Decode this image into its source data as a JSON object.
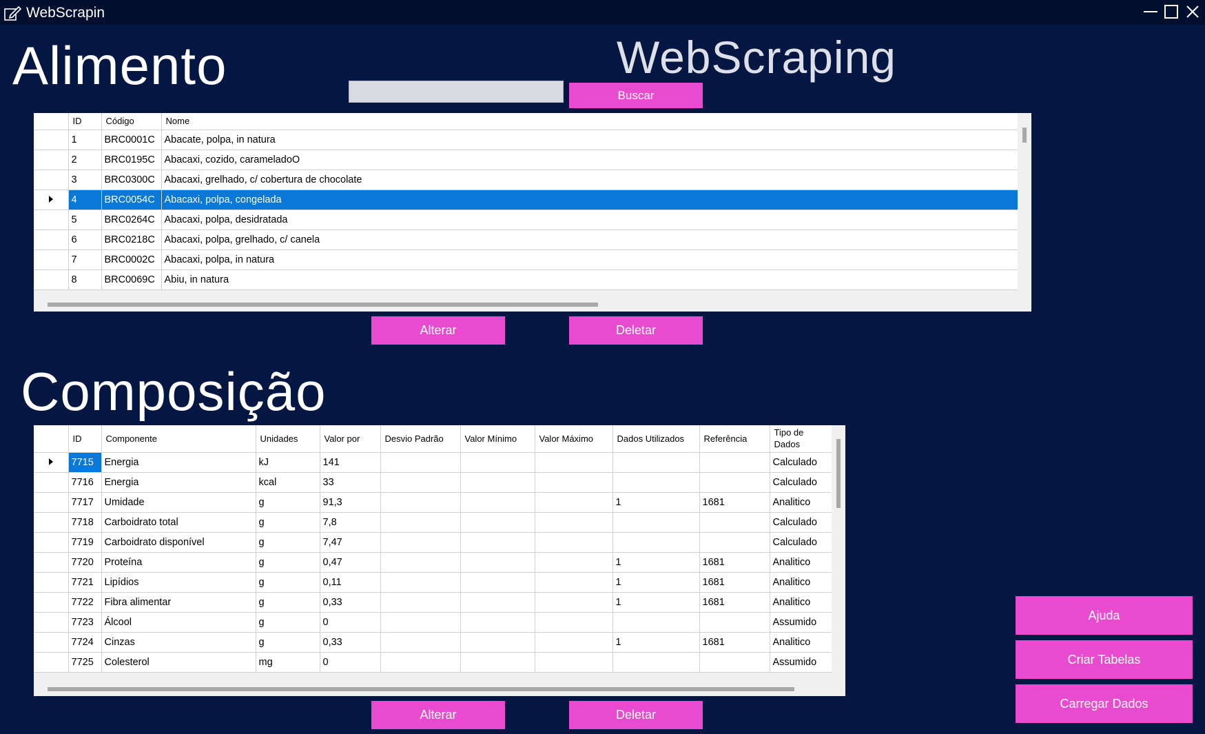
{
  "window": {
    "title": "WebScrapin",
    "app_icon": "pen-edit-icon",
    "controls": [
      "minimize-icon",
      "maximize-icon",
      "close-icon"
    ]
  },
  "headings": {
    "alimento": "Alimento",
    "composicao": "Composição",
    "brand": "WebScraping"
  },
  "search": {
    "value": "",
    "placeholder": "",
    "button_label": "Buscar"
  },
  "alimento_grid": {
    "columns": [
      "ID",
      "Código",
      "Nome"
    ],
    "selected_row": 3,
    "rows": [
      [
        "1",
        "BRC0001C",
        "Abacate, polpa, in natura"
      ],
      [
        "2",
        "BRC0195C",
        "Abacaxi, cozido, carameladoO"
      ],
      [
        "3",
        "BRC0300C",
        "Abacaxi, grelhado, c/ cobertura de chocolate"
      ],
      [
        "4",
        "BRC0054C",
        "Abacaxi, polpa, congelada"
      ],
      [
        "5",
        "BRC0264C",
        "Abacaxi, polpa, desidratada"
      ],
      [
        "6",
        "BRC0218C",
        "Abacaxi, polpa, grelhado, c/ canela"
      ],
      [
        "7",
        "BRC0002C",
        "Abacaxi, polpa, in natura"
      ],
      [
        "8",
        "BRC0069C",
        "Abiu, in natura"
      ]
    ]
  },
  "alimento_actions": {
    "alterar": "Alterar",
    "deletar": "Deletar"
  },
  "composicao_grid": {
    "columns": [
      "ID",
      "Componente",
      "Unidades",
      "Valor por",
      "Desvio Padrão",
      "Valor Mínimo",
      "Valor Máximo",
      "Dados Utilizados",
      "Referência",
      "Tipo de Dados"
    ],
    "rows": [
      [
        "7715",
        "Energia",
        "kJ",
        "141",
        "",
        "",
        "",
        "",
        "",
        "Calculado"
      ],
      [
        "7716",
        "Energia",
        "kcal",
        "33",
        "",
        "",
        "",
        "",
        "",
        "Calculado"
      ],
      [
        "7717",
        "Umidade",
        "g",
        "91,3",
        "",
        "",
        "",
        "1",
        "1681",
        "Analitico"
      ],
      [
        "7718",
        "Carboidrato total",
        "g",
        "7,8",
        "",
        "",
        "",
        "",
        "",
        "Calculado"
      ],
      [
        "7719",
        "Carboidrato disponível",
        "g",
        "7,47",
        "",
        "",
        "",
        "",
        "",
        "Calculado"
      ],
      [
        "7720",
        "Proteína",
        "g",
        "0,47",
        "",
        "",
        "",
        "1",
        "1681",
        "Analitico"
      ],
      [
        "7721",
        "Lipídios",
        "g",
        "0,11",
        "",
        "",
        "",
        "1",
        "1681",
        "Analitico"
      ],
      [
        "7722",
        "Fibra alimentar",
        "g",
        "0,33",
        "",
        "",
        "",
        "1",
        "1681",
        "Analitico"
      ],
      [
        "7723",
        "Álcool",
        "g",
        "0",
        "",
        "",
        "",
        "",
        "",
        "Assumido"
      ],
      [
        "7724",
        "Cinzas",
        "g",
        "0,33",
        "",
        "",
        "",
        "1",
        "1681",
        "Analitico"
      ],
      [
        "7725",
        "Colesterol",
        "mg",
        "0",
        "",
        "",
        "",
        "",
        "",
        "Assumido"
      ]
    ]
  },
  "composicao_actions": {
    "alterar": "Alterar",
    "deletar": "Deletar"
  },
  "side_actions": {
    "ajuda": "Ajuda",
    "criar_tabelas": "Criar Tabelas",
    "carregar_dados": "Carregar Dados"
  },
  "colors": {
    "background": "#041642",
    "accent": "#e94bd0",
    "selection": "#0a78d7"
  }
}
